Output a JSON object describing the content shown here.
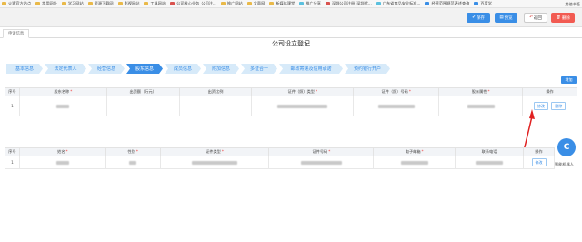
{
  "bookmarks": {
    "items": [
      "火狐官方站点",
      "常用网址",
      "学习网站",
      "资源下载网",
      "影视网站",
      "工具网站",
      "公司核心业务_公司注...",
      "推广网站",
      "文章网",
      "新媒体课堂",
      "推广分享",
      "深圳公司注册_深圳代...",
      "广东省食品安全标准...",
      "经营范围规范表述查询",
      "百度学"
    ],
    "right": "其他书签"
  },
  "toolbar": {
    "save": "保存",
    "preview": "预览",
    "back": "返回",
    "delete": "删除"
  },
  "tab": "申请信息",
  "page_title": "公司设立登记",
  "steps": [
    "基本信息",
    "法定代表人",
    "经营信息",
    "股东信息",
    "成员信息",
    "附加信息",
    "多证合一",
    "邮政寄递及信用承诺",
    "预约银行开户"
  ],
  "active_step": 3,
  "add_button": "增加",
  "shareholder_table": {
    "headers": [
      "序号",
      "股东名称",
      "出资额（万元）",
      "出资比例",
      "证件（照）类型",
      "证件（照）号码",
      "股东属性",
      "操作"
    ],
    "required": [
      false,
      true,
      false,
      false,
      true,
      true,
      true,
      false
    ],
    "rows": [
      {
        "index": "1",
        "edit": "修改",
        "delete": "删除"
      }
    ]
  },
  "member_table": {
    "headers": [
      "序号",
      "姓名",
      "性别",
      "证件类型",
      "证件号码",
      "电子邮箱",
      "联系电话",
      "操作"
    ],
    "required": [
      false,
      true,
      true,
      true,
      true,
      true,
      false,
      false
    ],
    "rows": [
      {
        "index": "1",
        "edit": "修改"
      }
    ]
  },
  "robot": {
    "icon_letter": "C",
    "label": "智能机器人"
  }
}
